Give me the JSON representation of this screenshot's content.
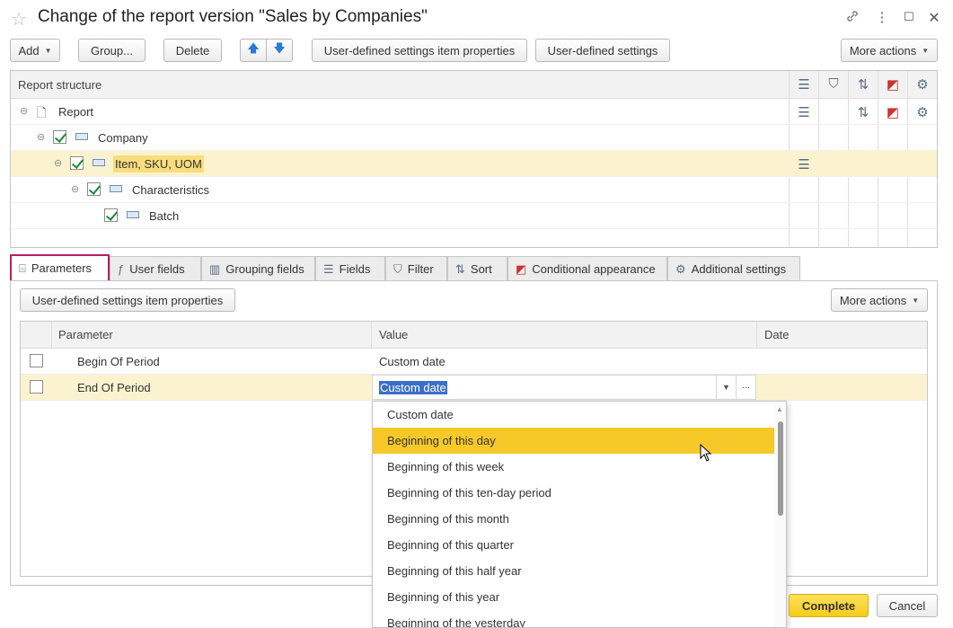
{
  "window": {
    "title": "Change of the report version \"Sales by Companies\"",
    "icons": [
      "star-icon",
      "link-icon",
      "more-vertical-icon",
      "maximize-icon",
      "close-icon"
    ]
  },
  "toolbar": {
    "add": "Add",
    "group": "Group...",
    "delete": "Delete",
    "item_properties": "User-defined settings item properties",
    "user_settings": "User-defined settings",
    "more_actions": "More actions"
  },
  "structure": {
    "header": "Report structure",
    "rows": [
      {
        "label": "Report",
        "checked": false
      },
      {
        "label": "Company",
        "checked": true
      },
      {
        "label": "Item, SKU, UOM",
        "checked": true,
        "selected": true
      },
      {
        "label": "Characteristics",
        "checked": true
      },
      {
        "label": "Batch",
        "checked": true
      }
    ]
  },
  "tabs": [
    {
      "label": "Parameters",
      "active": true
    },
    {
      "label": "User fields"
    },
    {
      "label": "Grouping fields"
    },
    {
      "label": "Fields"
    },
    {
      "label": "Filter"
    },
    {
      "label": "Sort"
    },
    {
      "label": "Conditional appearance"
    },
    {
      "label": "Additional settings"
    }
  ],
  "params_toolbar": {
    "item_properties": "User-defined settings item properties",
    "more_actions": "More actions"
  },
  "params_table": {
    "columns": [
      "Parameter",
      "Value",
      "Date"
    ],
    "rows": [
      {
        "parameter": "Begin Of Period",
        "value": "Custom date",
        "checked": false
      },
      {
        "parameter": "End Of Period",
        "value": "Custom date",
        "checked": false,
        "selected": true
      }
    ],
    "ellipsis": "..."
  },
  "dropdown": {
    "items": [
      "Custom date",
      "Beginning of this day",
      "Beginning of this week",
      "Beginning of this ten-day period",
      "Beginning of this month",
      "Beginning of this quarter",
      "Beginning of this half year",
      "Beginning of this year",
      "Beginning of the yesterday"
    ],
    "hovered_index": 1
  },
  "footer": {
    "complete": "Complete",
    "cancel": "Cancel"
  },
  "colors": {
    "accent": "#f4cc1c",
    "selection": "#fbf3d0",
    "active_tab_border": "#b51f62"
  }
}
